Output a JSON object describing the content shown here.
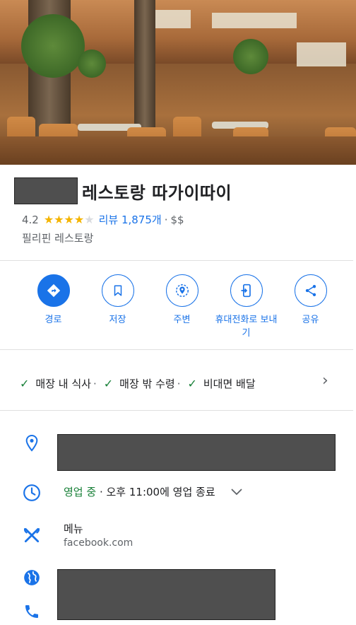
{
  "place": {
    "name": "레스토랑 따가이따이",
    "rating": "4.2",
    "stars_filled": 4,
    "stars_total": 5,
    "reviews_label": "리뷰 1,875개",
    "price_separator": "·",
    "price": "$$",
    "category": "필리핀 레스토랑"
  },
  "actions": [
    {
      "label": "경로",
      "icon": "directions-icon",
      "primary": true
    },
    {
      "label": "저장",
      "icon": "bookmark-icon",
      "primary": false
    },
    {
      "label": "주변",
      "icon": "nearby-icon",
      "primary": false
    },
    {
      "label": "휴대전화로 보내기",
      "icon": "send-to-phone-icon",
      "primary": false
    },
    {
      "label": "공유",
      "icon": "share-icon",
      "primary": false
    }
  ],
  "services": [
    {
      "label": "매장 내 식사",
      "sep": "·"
    },
    {
      "label": "매장 밖 수령",
      "sep": "·"
    },
    {
      "label": "비대면 배달",
      "sep": ""
    }
  ],
  "hours": {
    "status": "영업 중",
    "separator": " · ",
    "detail": "오후 11:00에 영업 종료"
  },
  "menu": {
    "title": "메뉴",
    "url": "facebook.com"
  },
  "colors": {
    "accent": "#1a73e8",
    "star": "#f4b400",
    "open": "#188038",
    "redaction": "#4f4f4f"
  }
}
